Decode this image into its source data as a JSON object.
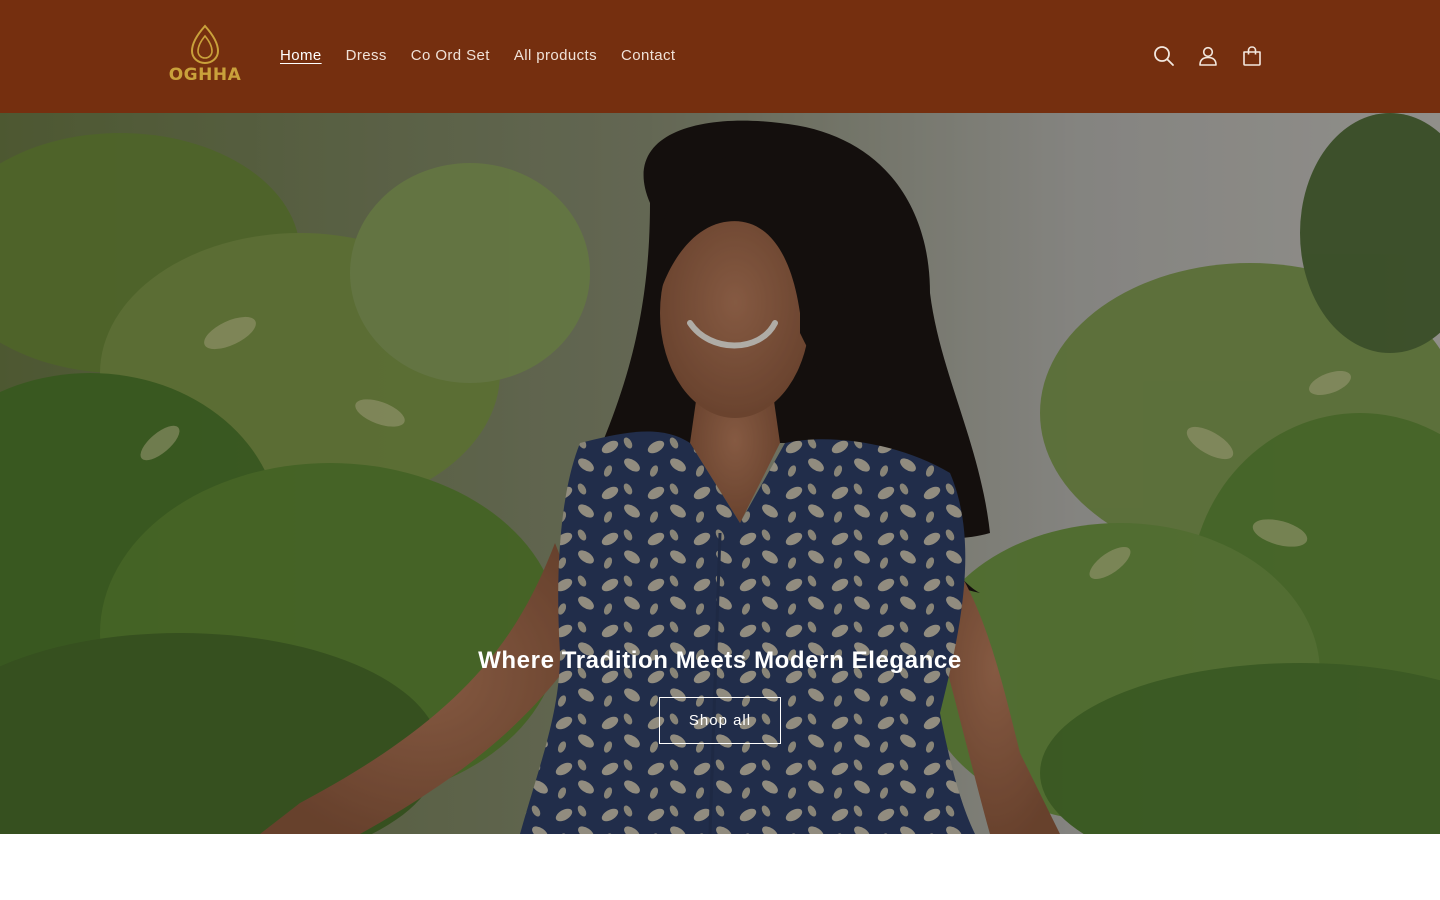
{
  "header": {
    "logo_text": "OGHHA",
    "nav": [
      {
        "label": "Home",
        "active": true
      },
      {
        "label": "Dress"
      },
      {
        "label": "Co Ord Set"
      },
      {
        "label": "All products"
      },
      {
        "label": "Contact"
      }
    ],
    "icons": [
      "search-icon",
      "account-icon",
      "cart-icon"
    ]
  },
  "hero": {
    "title": "Where Tradition Meets Modern Elegance",
    "button_label": "Shop all"
  },
  "colors": {
    "header_bg": "#752f0f",
    "logo_gold": "#c9a13b"
  }
}
